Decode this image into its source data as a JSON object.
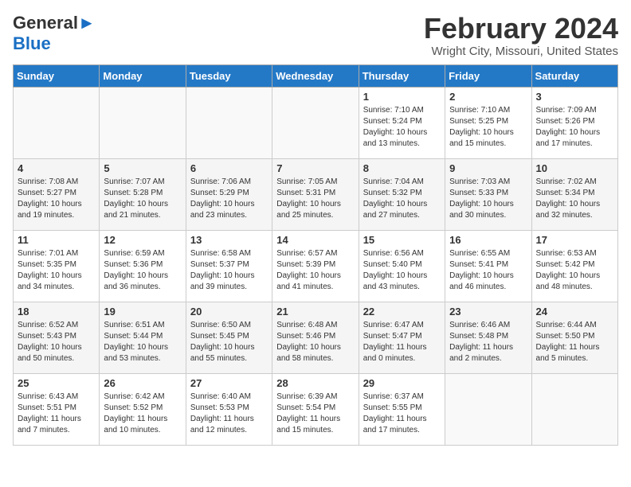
{
  "logo": {
    "line1": "General",
    "line2": "Blue"
  },
  "title": "February 2024",
  "subtitle": "Wright City, Missouri, United States",
  "days_of_week": [
    "Sunday",
    "Monday",
    "Tuesday",
    "Wednesday",
    "Thursday",
    "Friday",
    "Saturday"
  ],
  "weeks": [
    [
      {
        "day": "",
        "info": ""
      },
      {
        "day": "",
        "info": ""
      },
      {
        "day": "",
        "info": ""
      },
      {
        "day": "",
        "info": ""
      },
      {
        "day": "1",
        "info": "Sunrise: 7:10 AM\nSunset: 5:24 PM\nDaylight: 10 hours\nand 13 minutes."
      },
      {
        "day": "2",
        "info": "Sunrise: 7:10 AM\nSunset: 5:25 PM\nDaylight: 10 hours\nand 15 minutes."
      },
      {
        "day": "3",
        "info": "Sunrise: 7:09 AM\nSunset: 5:26 PM\nDaylight: 10 hours\nand 17 minutes."
      }
    ],
    [
      {
        "day": "4",
        "info": "Sunrise: 7:08 AM\nSunset: 5:27 PM\nDaylight: 10 hours\nand 19 minutes."
      },
      {
        "day": "5",
        "info": "Sunrise: 7:07 AM\nSunset: 5:28 PM\nDaylight: 10 hours\nand 21 minutes."
      },
      {
        "day": "6",
        "info": "Sunrise: 7:06 AM\nSunset: 5:29 PM\nDaylight: 10 hours\nand 23 minutes."
      },
      {
        "day": "7",
        "info": "Sunrise: 7:05 AM\nSunset: 5:31 PM\nDaylight: 10 hours\nand 25 minutes."
      },
      {
        "day": "8",
        "info": "Sunrise: 7:04 AM\nSunset: 5:32 PM\nDaylight: 10 hours\nand 27 minutes."
      },
      {
        "day": "9",
        "info": "Sunrise: 7:03 AM\nSunset: 5:33 PM\nDaylight: 10 hours\nand 30 minutes."
      },
      {
        "day": "10",
        "info": "Sunrise: 7:02 AM\nSunset: 5:34 PM\nDaylight: 10 hours\nand 32 minutes."
      }
    ],
    [
      {
        "day": "11",
        "info": "Sunrise: 7:01 AM\nSunset: 5:35 PM\nDaylight: 10 hours\nand 34 minutes."
      },
      {
        "day": "12",
        "info": "Sunrise: 6:59 AM\nSunset: 5:36 PM\nDaylight: 10 hours\nand 36 minutes."
      },
      {
        "day": "13",
        "info": "Sunrise: 6:58 AM\nSunset: 5:37 PM\nDaylight: 10 hours\nand 39 minutes."
      },
      {
        "day": "14",
        "info": "Sunrise: 6:57 AM\nSunset: 5:39 PM\nDaylight: 10 hours\nand 41 minutes."
      },
      {
        "day": "15",
        "info": "Sunrise: 6:56 AM\nSunset: 5:40 PM\nDaylight: 10 hours\nand 43 minutes."
      },
      {
        "day": "16",
        "info": "Sunrise: 6:55 AM\nSunset: 5:41 PM\nDaylight: 10 hours\nand 46 minutes."
      },
      {
        "day": "17",
        "info": "Sunrise: 6:53 AM\nSunset: 5:42 PM\nDaylight: 10 hours\nand 48 minutes."
      }
    ],
    [
      {
        "day": "18",
        "info": "Sunrise: 6:52 AM\nSunset: 5:43 PM\nDaylight: 10 hours\nand 50 minutes."
      },
      {
        "day": "19",
        "info": "Sunrise: 6:51 AM\nSunset: 5:44 PM\nDaylight: 10 hours\nand 53 minutes."
      },
      {
        "day": "20",
        "info": "Sunrise: 6:50 AM\nSunset: 5:45 PM\nDaylight: 10 hours\nand 55 minutes."
      },
      {
        "day": "21",
        "info": "Sunrise: 6:48 AM\nSunset: 5:46 PM\nDaylight: 10 hours\nand 58 minutes."
      },
      {
        "day": "22",
        "info": "Sunrise: 6:47 AM\nSunset: 5:47 PM\nDaylight: 11 hours\nand 0 minutes."
      },
      {
        "day": "23",
        "info": "Sunrise: 6:46 AM\nSunset: 5:48 PM\nDaylight: 11 hours\nand 2 minutes."
      },
      {
        "day": "24",
        "info": "Sunrise: 6:44 AM\nSunset: 5:50 PM\nDaylight: 11 hours\nand 5 minutes."
      }
    ],
    [
      {
        "day": "25",
        "info": "Sunrise: 6:43 AM\nSunset: 5:51 PM\nDaylight: 11 hours\nand 7 minutes."
      },
      {
        "day": "26",
        "info": "Sunrise: 6:42 AM\nSunset: 5:52 PM\nDaylight: 11 hours\nand 10 minutes."
      },
      {
        "day": "27",
        "info": "Sunrise: 6:40 AM\nSunset: 5:53 PM\nDaylight: 11 hours\nand 12 minutes."
      },
      {
        "day": "28",
        "info": "Sunrise: 6:39 AM\nSunset: 5:54 PM\nDaylight: 11 hours\nand 15 minutes."
      },
      {
        "day": "29",
        "info": "Sunrise: 6:37 AM\nSunset: 5:55 PM\nDaylight: 11 hours\nand 17 minutes."
      },
      {
        "day": "",
        "info": ""
      },
      {
        "day": "",
        "info": ""
      }
    ]
  ]
}
